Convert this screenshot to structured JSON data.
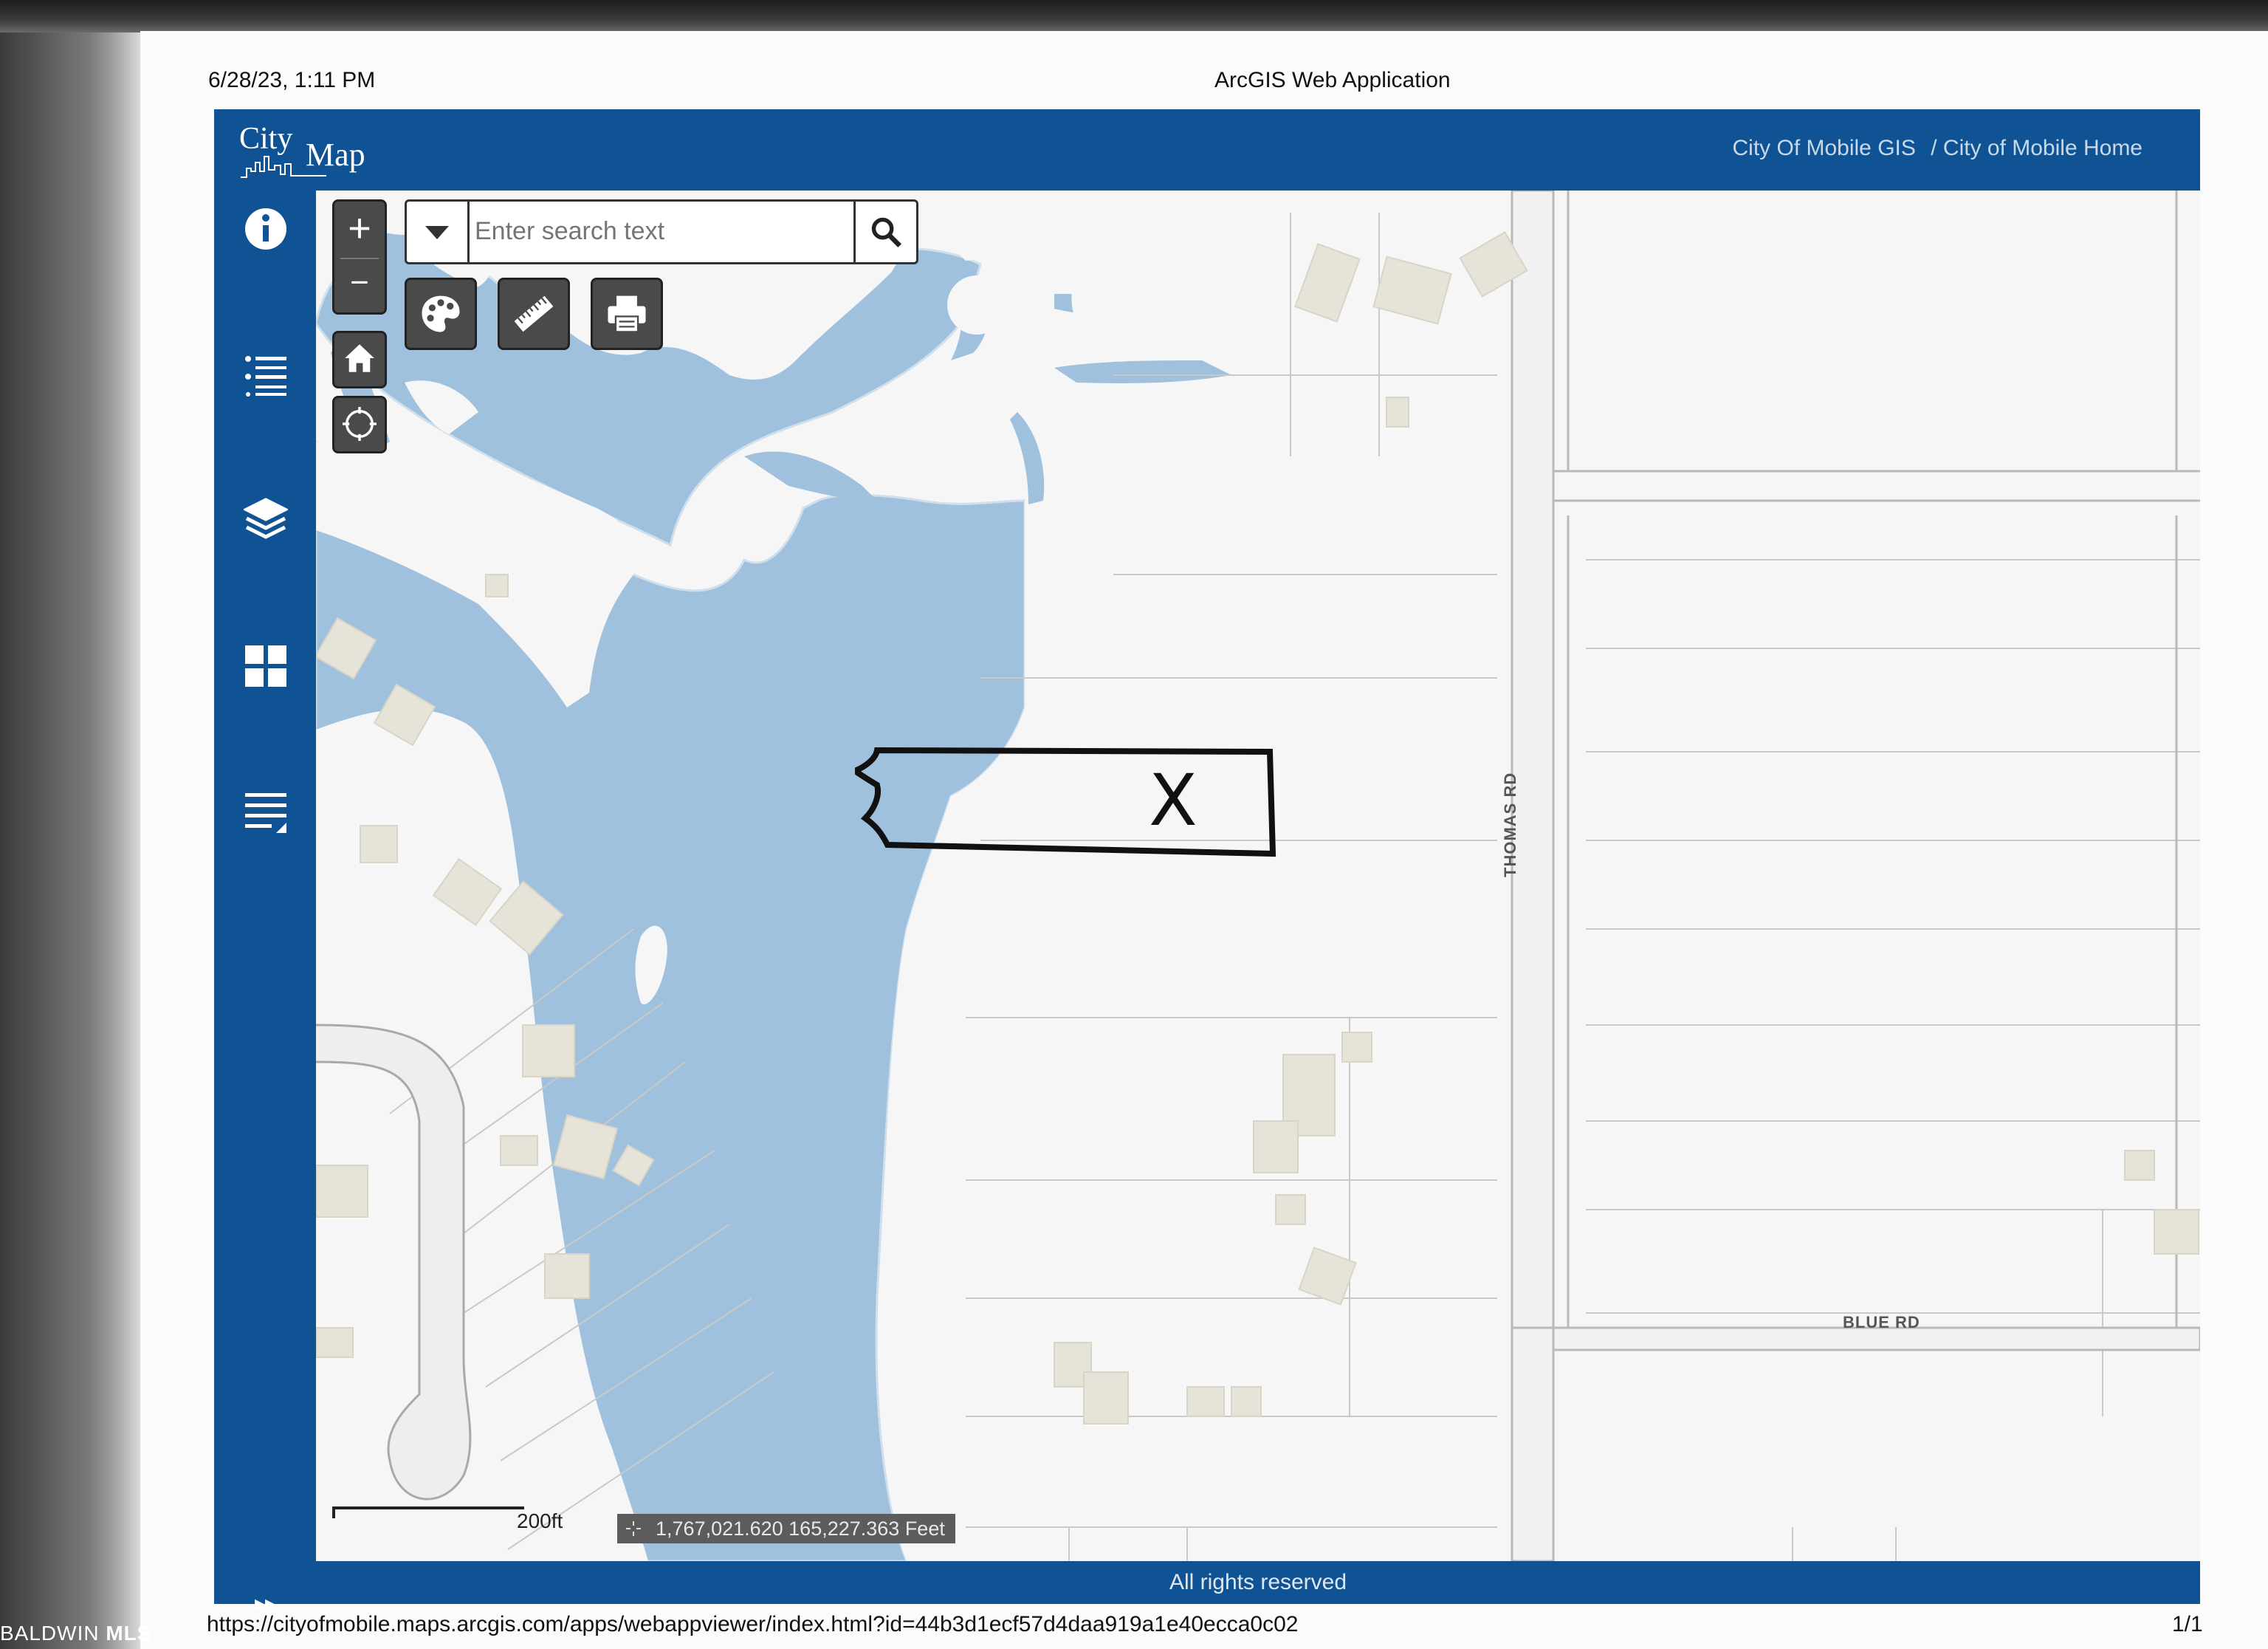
{
  "print_header": {
    "date": "6/28/23, 1:11 PM",
    "title": "ArcGIS Web Application"
  },
  "print_footer": {
    "url": "https://cityofmobile.maps.arcgis.com/apps/webappviewer/index.html?id=44b3d1ecf57d4daa919a1e40ecca0c02",
    "page": "1/1"
  },
  "watermark": {
    "left": "BALDWIN",
    "right": "MLS"
  },
  "app": {
    "logo": {
      "line1": "City",
      "line2": "Map"
    },
    "links": [
      {
        "label": "City Of Mobile GIS"
      },
      {
        "label": "/ City of Mobile Home"
      }
    ],
    "sidebar_icons": [
      "info-icon",
      "legend-list-icon",
      "layers-icon",
      "widgets-grid-icon",
      "attribute-table-icon"
    ],
    "expand_label": "▸▸",
    "footer_text": "All rights reserved"
  },
  "map": {
    "zoom_in": "+",
    "zoom_out": "−",
    "search": {
      "placeholder": "Enter search text",
      "value": ""
    },
    "tools": [
      "draw-palette-icon",
      "measure-ruler-icon",
      "print-icon"
    ],
    "scale_label": "200ft",
    "coordinates": "1,767,021.620 165,227.363 Feet",
    "road_labels": {
      "thomas": "THOMAS RD",
      "blue": "BLUE RD"
    },
    "annotation_mark": "X",
    "colors": {
      "water": "#9fc1dd",
      "land": "#f6f6f6",
      "building": "#e6e3d8",
      "accent": "#0f5394"
    }
  }
}
